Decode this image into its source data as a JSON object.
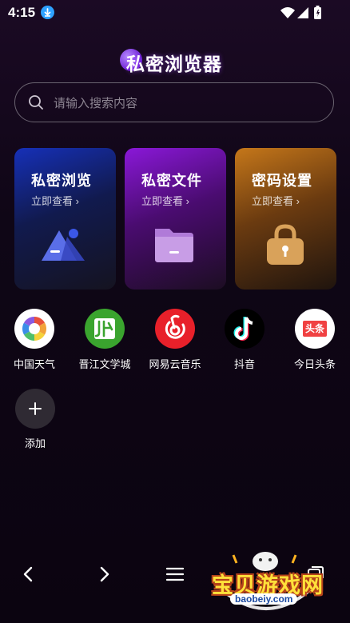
{
  "status": {
    "time": "4:15"
  },
  "app": {
    "title": "私密浏览器"
  },
  "search": {
    "placeholder": "请输入搜索内容"
  },
  "cards": [
    {
      "title": "私密浏览",
      "subtitle": "立即查看 ›",
      "icon": "shapes-icon"
    },
    {
      "title": "私密文件",
      "subtitle": "立即查看 ›",
      "icon": "folder-icon"
    },
    {
      "title": "密码设置",
      "subtitle": "立即查看 ›",
      "icon": "lock-icon"
    }
  ],
  "shortcuts": [
    {
      "label": "中国天气",
      "icon": "weather-app-icon"
    },
    {
      "label": "晋江文学城",
      "icon": "jinjiang-app-icon"
    },
    {
      "label": "网易云音乐",
      "icon": "netease-music-icon"
    },
    {
      "label": "抖音",
      "icon": "douyin-icon"
    },
    {
      "label": "今日头条",
      "icon": "toutiao-icon"
    }
  ],
  "add": {
    "label": "添加"
  },
  "toutiao_icon_text": "头条",
  "watermark": {
    "text": "宝贝游戏网",
    "url": "baobeiy.com"
  },
  "colors": {
    "accent_blue": "#1630b8",
    "accent_purple": "#8a18d8",
    "accent_orange": "#c5771a",
    "background": "#0b0410"
  }
}
